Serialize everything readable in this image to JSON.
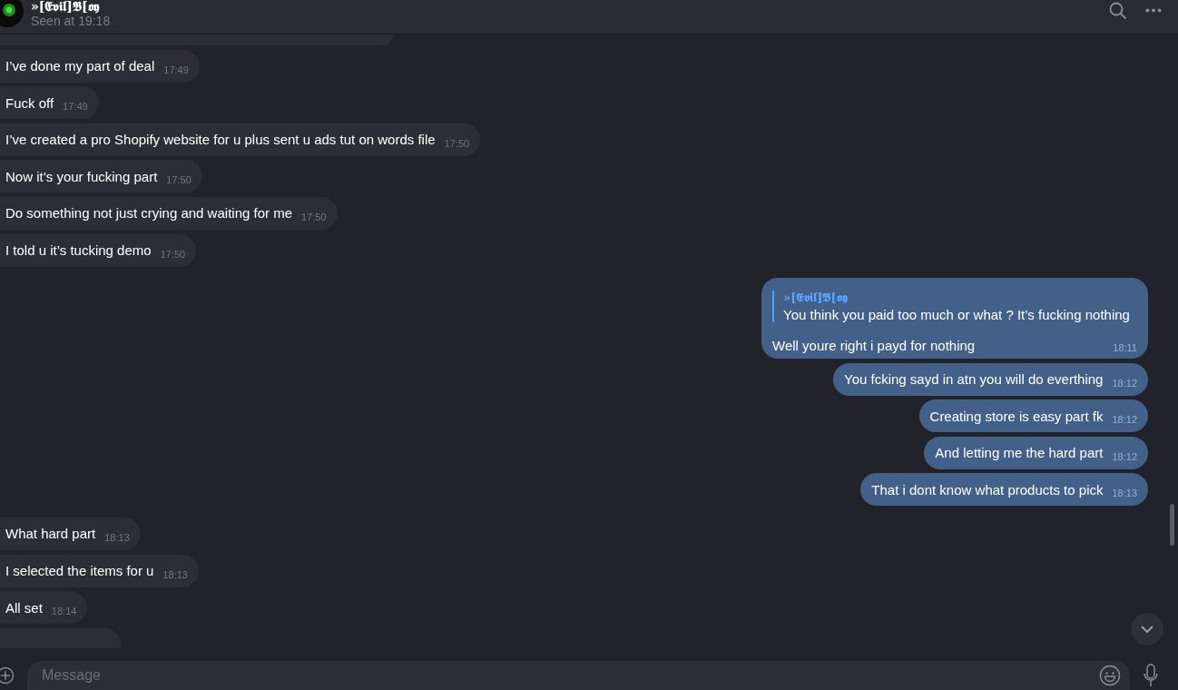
{
  "header": {
    "name": "»[𝕰𝖛𝖎𝖑]𝕭[𝖔𝖞",
    "status": "Seen at 19:18"
  },
  "messages": [
    {
      "kind": "received_cut_top"
    },
    {
      "kind": "received",
      "text": "I’ve done my part of deal",
      "time": "17:49"
    },
    {
      "kind": "received",
      "text": "Fuck off",
      "time": "17:49"
    },
    {
      "kind": "received",
      "text": "I’ve created a pro Shopify website for u plus sent u ads tut on words file",
      "time": "17:50"
    },
    {
      "kind": "received",
      "text": "Now it’s your fucking part",
      "time": "17:50"
    },
    {
      "kind": "received",
      "text": "Do something not just crying and waiting for me",
      "time": "17:50"
    },
    {
      "kind": "received",
      "text": "I told u it’s tucking demo",
      "time": "17:50"
    },
    {
      "kind": "sent_reply",
      "quote_author": "»[𝕰𝖛𝖎𝖑]𝕭[𝖔𝖞",
      "quote_text": "You think you paid too much or what ? It’s fucking nothing",
      "text": "Well youre right i payd for nothing",
      "time": "18:11"
    },
    {
      "kind": "sent",
      "text": "You fcking sayd in atn you will do everthing",
      "time": "18:12"
    },
    {
      "kind": "sent",
      "text": "Creating store is easy part fk",
      "time": "18:12"
    },
    {
      "kind": "sent",
      "text": "And letting me the hard part",
      "time": "18:12"
    },
    {
      "kind": "sent",
      "text": "That i dont know what products to pick",
      "time": "18:13"
    },
    {
      "kind": "received",
      "text": "What hard part",
      "time": "18:13"
    },
    {
      "kind": "received",
      "text": "I selected the items for u",
      "time": "18:13"
    },
    {
      "kind": "received",
      "text": "All set",
      "time": "18:14"
    },
    {
      "kind": "received_cut_bottom"
    }
  ],
  "composer": {
    "placeholder": "Message"
  }
}
